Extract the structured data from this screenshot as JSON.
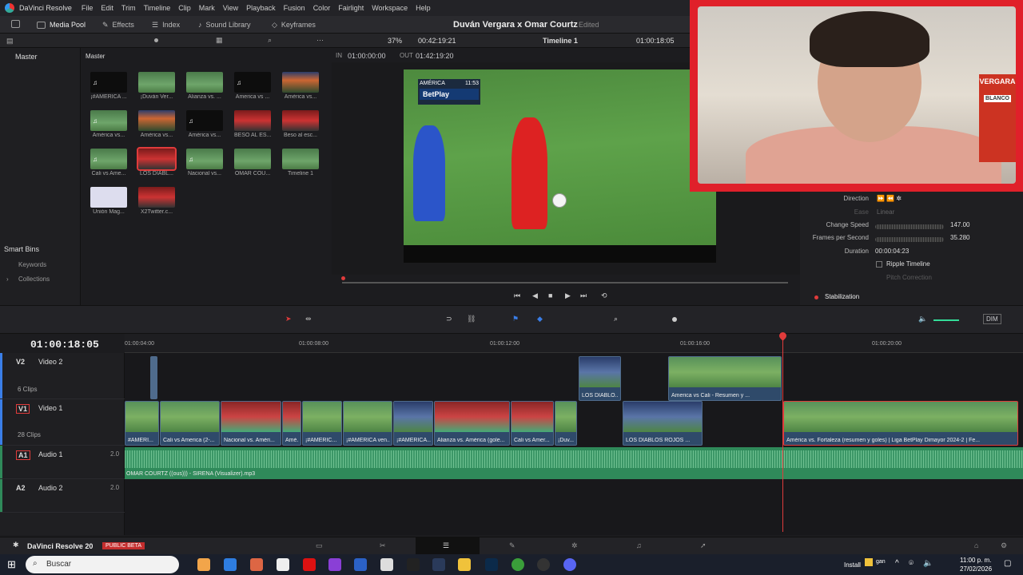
{
  "app": {
    "name": "DaVinci Resolve",
    "menus": [
      "File",
      "Edit",
      "Trim",
      "Timeline",
      "Clip",
      "Mark",
      "View",
      "Playback",
      "Fusion",
      "Color",
      "Fairlight",
      "Workspace",
      "Help"
    ],
    "project_title": "Duván Vergara x Omar Courtz",
    "project_status": "Edited",
    "footer_label": "DaVinci Resolve 20",
    "beta_badge": "PUBLIC BETA"
  },
  "toolbar": {
    "media_pool": "Media Pool",
    "effects": "Effects",
    "index": "Index",
    "sound_library": "Sound Library",
    "keyframes": "Keyframes"
  },
  "media_pool": {
    "bin_title": "Master",
    "panel_title": "Master",
    "clips": [
      {
        "label": "¡#AMERICA ...",
        "style": "dark",
        "note": "♫"
      },
      {
        "label": "¡Duván Ver...",
        "style": "field"
      },
      {
        "label": "Alianza vs. ...",
        "style": "field"
      },
      {
        "label": "America vs ...",
        "style": "dark",
        "note": "♫"
      },
      {
        "label": "América vs...",
        "style": "crowd"
      },
      {
        "label": "América vs...",
        "style": "field",
        "note": "♫"
      },
      {
        "label": "América vs...",
        "style": "crowd"
      },
      {
        "label": "América vs...",
        "style": "dark",
        "note": "♫"
      },
      {
        "label": "BESO AL ES...",
        "style": "red"
      },
      {
        "label": "Beso al esc...",
        "style": "red"
      },
      {
        "label": "Cali vs Ame...",
        "style": "field",
        "note": "♫"
      },
      {
        "label": "LOS DIABL...",
        "style": "red",
        "selected": true
      },
      {
        "label": "Nacional vs...",
        "style": "field",
        "note": "♫"
      },
      {
        "label": "OMAR COU...",
        "style": "field"
      },
      {
        "label": "Timeline 1",
        "style": "field"
      },
      {
        "label": "Unión Mag...",
        "style": "card"
      },
      {
        "label": "X2Twitter.c...",
        "style": "red"
      }
    ],
    "smart_bins_title": "Smart Bins",
    "smart_bins": [
      "Keywords",
      "Collections"
    ]
  },
  "viewer": {
    "zoom": "37%",
    "source_timecode": "00:42:19:21",
    "timeline_name": "Timeline 1",
    "record_timecode": "01:00:18:05",
    "in_label": "IN",
    "in_tc": "01:00:00:00",
    "out_label": "OUT",
    "out_tc": "01:42:19:20",
    "scorebug": {
      "team": "AMÉRICA",
      "time": "11:53",
      "sponsor": "BetPlay"
    }
  },
  "inspector": {
    "direction_label": "Direction",
    "ease_label": "Ease",
    "ease_value": "Linear",
    "change_speed_label": "Change Speed",
    "change_speed_value": "147.00",
    "fps_label": "Frames per Second",
    "fps_value": "35.280",
    "duration_label": "Duration",
    "duration_value": "00:00:04:23",
    "ripple_label": "Ripple Timeline",
    "pitch_label": "Pitch Correction",
    "stabilization_label": "Stabilization"
  },
  "webcam": {
    "jersey_text": "VERGARA",
    "patch_text": "BLANCO"
  },
  "timeline": {
    "timecode": "01:00:18:05",
    "ruler_ticks": [
      "01:00:04:00",
      "01:00:08:00",
      "01:00:12:00",
      "01:00:16:00",
      "01:00:20:00"
    ],
    "dim_label": "DIM",
    "tracks": [
      {
        "id": "V2",
        "name": "Video 2",
        "count": "6 Clips"
      },
      {
        "id": "V1",
        "name": "Video 1",
        "count": "28 Clips"
      },
      {
        "id": "A1",
        "name": "Audio 1",
        "gain": "2.0"
      },
      {
        "id": "A2",
        "name": "Audio 2",
        "gain": "2.0"
      }
    ],
    "v2_clips": [
      {
        "label": "LOS DIABLO..."
      },
      {
        "label": "America vs Cali - Resumen y ..."
      }
    ],
    "v1_clips": [
      {
        "label": "#AMERI..."
      },
      {
        "label": "Cali vs America (2-..."
      },
      {
        "label": "Nacional vs. Améri..."
      },
      {
        "label": "Amé..."
      },
      {
        "label": "¡#AMERIC..."
      },
      {
        "label": "¡#AMERICA ven..."
      },
      {
        "label": "¡#AMERICA..."
      },
      {
        "label": "Alianza vs. América (gole..."
      },
      {
        "label": "Cali vs Amer..."
      },
      {
        "label": "¡Duv..."
      },
      {
        "label": "LOS DIABLOS ROJOS ..."
      },
      {
        "label": "América vs. Fortaleza (resumen y goles) | Liga BetPlay Dimayor 2024-2 | Fe..."
      }
    ],
    "audio_clip_label": "OMAR COURTZ ((ous))) - SIRENA (Visualizer).mp3"
  },
  "taskbar": {
    "search_placeholder": "Buscar",
    "install_label": "Install",
    "time": "11:00 p. m.",
    "date": "27/02/2026"
  },
  "colors": {
    "accent_red": "#e03b3b",
    "audio_green": "#2f8a5a",
    "webcam_frame": "#e0202a"
  }
}
